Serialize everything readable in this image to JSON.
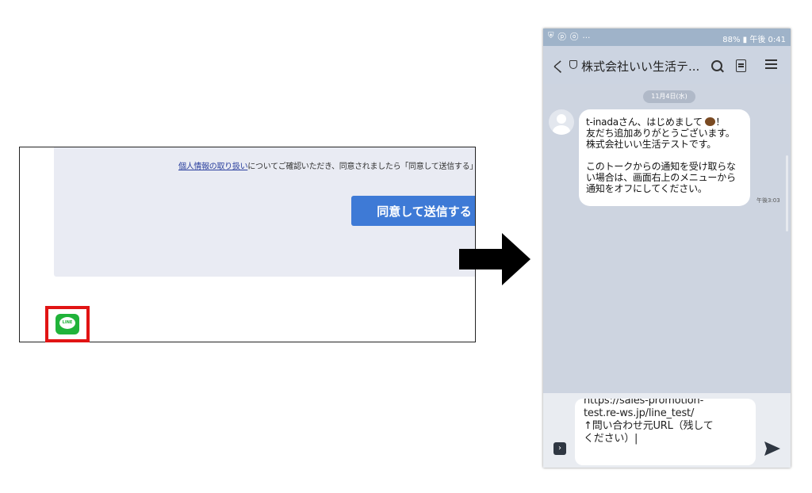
{
  "web": {
    "notice_link": "個人情報の取り扱い",
    "notice_text": "についてご確認いただき、同意されましたら「同意して送信する」",
    "submit_label": "同意して送信する",
    "line_icon_text": "LINE"
  },
  "phone": {
    "status_left": "⛨ ⓟ ⓞ …",
    "status_right": "88% ▮ 午後 0:41",
    "back_glyph": "く",
    "chat_title": "株式会社いい生活テ...",
    "date_label": "11月4日(水)",
    "message_lines": [
      "t-inadaさん、はじめまして",
      "友だち追加ありがとうございます。",
      "株式会社いい生活テストです。",
      "",
      "このトークからの通知を受け取らな",
      "い場合は、画面右上のメニューから",
      "通知をオフにしてください。"
    ],
    "message_exclaim": "！",
    "message_time": "午後3:03",
    "expand_glyph": "›",
    "input_text": "https://sales-promotion-\ntest.re-ws.jp/line_test/\n↑問い合わせ元URL（残して\nください）|"
  },
  "colors": {
    "button_blue": "#3e7ad6",
    "line_green": "#20b33a",
    "highlight_red": "#e11414",
    "phone_bg": "#cdd4e0"
  }
}
